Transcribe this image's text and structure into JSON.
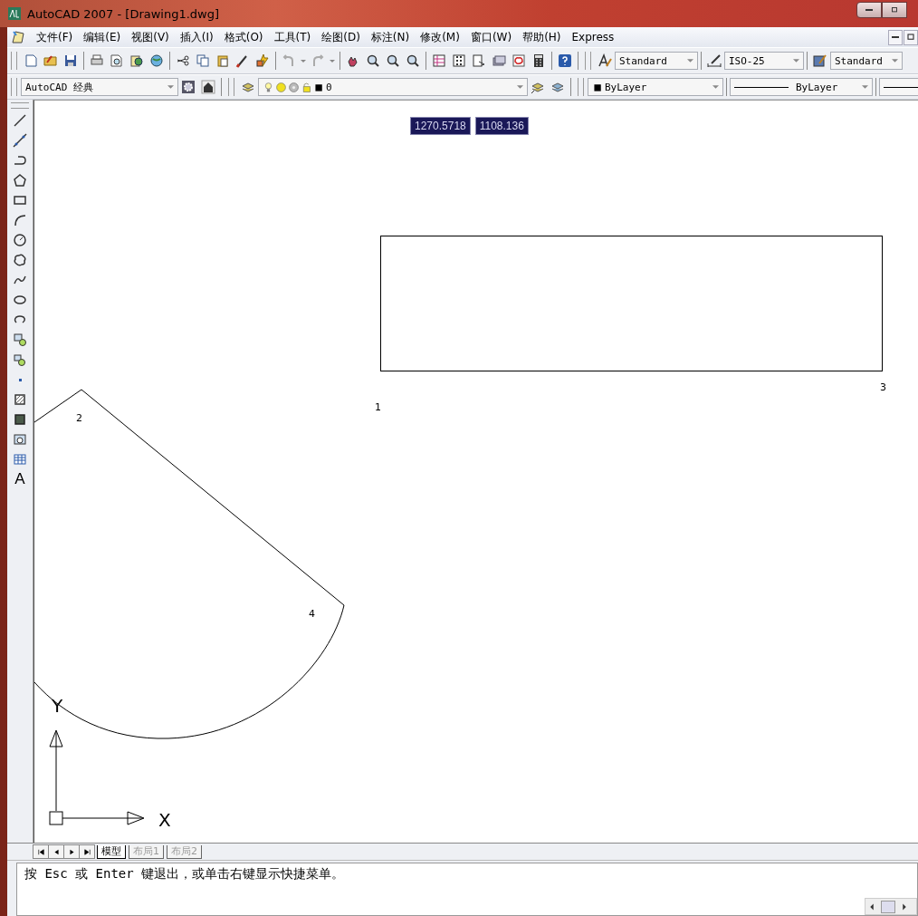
{
  "window": {
    "title": "AutoCAD 2007 - [Drawing1.dwg]"
  },
  "menu_bar": {
    "items": [
      "文件(F)",
      "编辑(E)",
      "视图(V)",
      "插入(I)",
      "格式(O)",
      "工具(T)",
      "绘图(D)",
      "标注(N)",
      "修改(M)",
      "窗口(W)",
      "帮助(H)",
      "Express"
    ]
  },
  "standard_toolbar": {
    "text_style": "Standard",
    "dimension_style": "ISO-25",
    "table_style": "Standard"
  },
  "workspace_toolbar": {
    "workspace": "AutoCAD 经典"
  },
  "layer_toolbar": {
    "layer": "0"
  },
  "properties_toolbar": {
    "color_setting": "ByLayer",
    "linetype": "ByLayer"
  },
  "draw_toolbar": {
    "text_button": "A"
  },
  "canvas": {
    "coordinate_tooltips": [
      "1270.5718",
      "1108.136"
    ],
    "point_labels": [
      "1",
      "2",
      "3",
      "4"
    ],
    "ucs": {
      "x_label": "X",
      "y_label": "Y"
    }
  },
  "layout_tabs": [
    {
      "label": "模型",
      "selected": true
    },
    {
      "label": "布局1",
      "selected": false
    },
    {
      "label": "布局2",
      "selected": false
    }
  ],
  "command_line": {
    "text": "按 Esc 或 Enter 键退出，或单击右键显示快捷菜单。"
  }
}
